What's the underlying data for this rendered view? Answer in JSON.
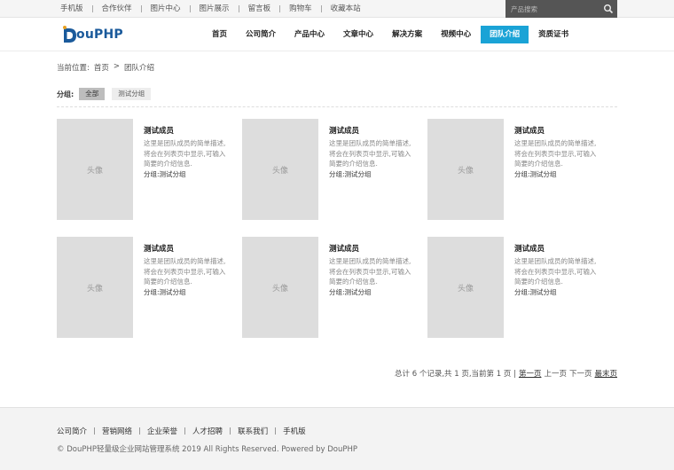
{
  "top_links": [
    "手机版",
    "合作伙伴",
    "图片中心",
    "图片展示",
    "留言板",
    "购物车",
    "收藏本站"
  ],
  "search": {
    "placeholder": "产品搜索"
  },
  "logo": {
    "prefix": "D",
    "text": "ouPHP"
  },
  "nav": [
    {
      "label": "首页",
      "active": false
    },
    {
      "label": "公司简介",
      "active": false
    },
    {
      "label": "产品中心",
      "active": false
    },
    {
      "label": "文章中心",
      "active": false
    },
    {
      "label": "解决方案",
      "active": false
    },
    {
      "label": "视频中心",
      "active": false
    },
    {
      "label": "团队介绍",
      "active": true
    },
    {
      "label": "资质证书",
      "active": false
    }
  ],
  "breadcrumb": {
    "label": "当前位置:",
    "home": "首页",
    "sep": ">",
    "current": "团队介绍"
  },
  "filter": {
    "label": "分组:",
    "all": "全部",
    "group": "测试分组"
  },
  "members": [
    {
      "avatar": "头像",
      "name": "测试成员",
      "desc1": "这里是团队成员的简单描述,",
      "desc2": "将会在列表页中显示,可输入",
      "desc3": "简要的介绍信息.",
      "group": "分组:测试分组"
    },
    {
      "avatar": "头像",
      "name": "测试成员",
      "desc1": "这里是团队成员的简单描述,",
      "desc2": "将会在列表页中显示,可输入",
      "desc3": "简要的介绍信息.",
      "group": "分组:测试分组"
    },
    {
      "avatar": "头像",
      "name": "测试成员",
      "desc1": "这里是团队成员的简单描述,",
      "desc2": "将会在列表页中显示,可输入",
      "desc3": "简要的介绍信息.",
      "group": "分组:测试分组"
    },
    {
      "avatar": "头像",
      "name": "测试成员",
      "desc1": "这里是团队成员的简单描述,",
      "desc2": "将会在列表页中显示,可输入",
      "desc3": "简要的介绍信息.",
      "group": "分组:测试分组"
    },
    {
      "avatar": "头像",
      "name": "测试成员",
      "desc1": "这里是团队成员的简单描述,",
      "desc2": "将会在列表页中显示,可输入",
      "desc3": "简要的介绍信息.",
      "group": "分组:测试分组"
    },
    {
      "avatar": "头像",
      "name": "测试成员",
      "desc1": "这里是团队成员的简单描述,",
      "desc2": "将会在列表页中显示,可输入",
      "desc3": "简要的介绍信息.",
      "group": "分组:测试分组"
    }
  ],
  "pager": {
    "summary": "总计 6 个记录,共 1 页,当前第 1 页 |",
    "first": "第一页",
    "prev": "上一页",
    "next": "下一页",
    "last": "最末页"
  },
  "footer_links": [
    "公司简介",
    "营销网络",
    "企业荣誉",
    "人才招聘",
    "联系我们",
    "手机版"
  ],
  "copyright": "© DouPHP轻量级企业网站管理系统 2019 All Rights Reserved. Powered by DouPHP",
  "colors": {
    "accent": "#1aa3d6",
    "logo": "#1a5a9b",
    "search_bg": "#555555"
  }
}
